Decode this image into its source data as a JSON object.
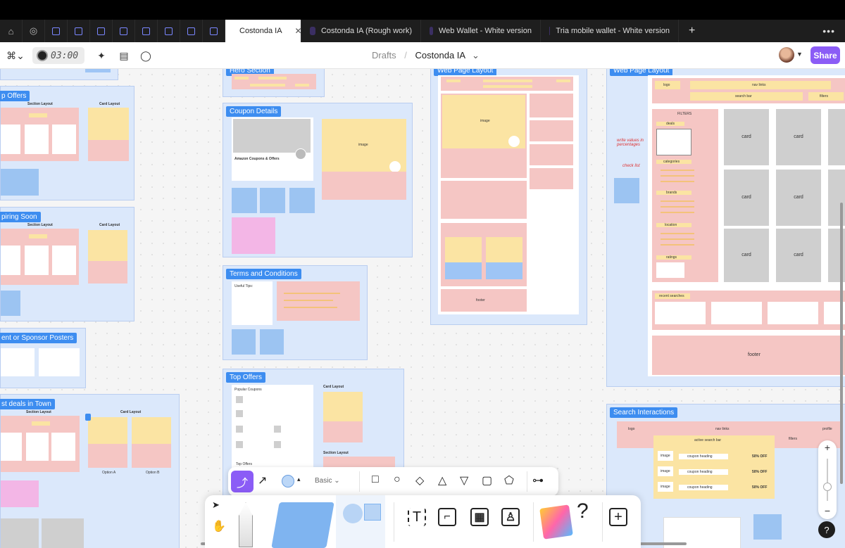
{
  "tabs": {
    "active": {
      "label": "Costonda IA",
      "close": "✕"
    },
    "others": [
      {
        "label": "Costonda IA (Rough work)"
      },
      {
        "label": "Web Wallet - White version"
      },
      {
        "label": "Tria mobile wallet - White version"
      }
    ],
    "plus": "+",
    "more": "•••"
  },
  "toolbar": {
    "timer": "03:00",
    "breadcrumb_parent": "Drafts",
    "breadcrumb_sep": "/",
    "file_name": "Costonda IA",
    "file_chevron": "⌄",
    "share": "Share"
  },
  "canvas": {
    "left_sections": [
      {
        "label": "p Offers"
      },
      {
        "label": "piring Soon"
      },
      {
        "label": "ent or Sponsor Posters"
      },
      {
        "label": "st deals in Town"
      }
    ],
    "mid_sections": [
      {
        "label": "Hero Section"
      },
      {
        "label": "Coupon Details"
      },
      {
        "label": "Terms and Conditions"
      },
      {
        "label": "Top Offers"
      }
    ],
    "right_sections": [
      {
        "label": "Web Page Layout"
      },
      {
        "label": "Web Page Layout"
      },
      {
        "label": "Search Interactions"
      }
    ],
    "texts": {
      "section_layout": "Section Layout",
      "card_layout": "Card Layout",
      "image": "image",
      "heading": "heading",
      "card": "card",
      "footer": "footer",
      "filters": "FILTERS",
      "deals": "deals",
      "categories": "categories",
      "brands": "brands",
      "location": "location",
      "ratings": "ratings",
      "recent_searches": "recent searches",
      "logo": "logo",
      "nav_links": "nav links",
      "search_bar": "search bar",
      "active_search_bar": "active search bar",
      "coupon_heading": "coupon heading",
      "discount": "50% OFF",
      "profile": "profile",
      "filters_small": "filters",
      "amazon": "Amazon Coupons & Offers",
      "popular_coupons": "Popular Coupons",
      "option_a": "Option A",
      "option_b": "Option B",
      "useful_tips": "Useful Tips:",
      "write_values": "write values in percentages",
      "check_list": "check list",
      "top_offers_small": "Top Offers"
    }
  },
  "shape_toolbar": {
    "style": "Basic",
    "style_chevron": "⌄"
  },
  "zoom": {
    "plus": "+",
    "minus": "−"
  },
  "help": "?"
}
